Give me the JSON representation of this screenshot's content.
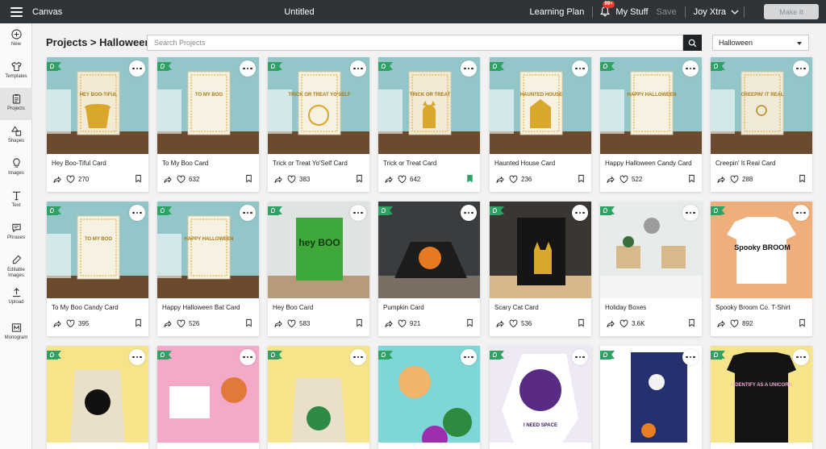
{
  "topbar": {
    "app_name": "Canvas",
    "doc_title": "Untitled",
    "learning_plan": "Learning Plan",
    "notif_badge": "99+",
    "my_stuff": "My Stuff",
    "save": "Save",
    "user": "Joy Xtra",
    "make_it": "Make It"
  },
  "sidebar": {
    "items": [
      {
        "label": "New",
        "icon": "plus-icon"
      },
      {
        "label": "Templates",
        "icon": "tshirt-icon"
      },
      {
        "label": "Projects",
        "icon": "clipboard-icon"
      },
      {
        "label": "Shapes",
        "icon": "shapes-icon"
      },
      {
        "label": "Images",
        "icon": "lightbulb-icon"
      },
      {
        "label": "Text",
        "icon": "text-icon"
      },
      {
        "label": "Phrases",
        "icon": "speech-icon"
      },
      {
        "label": "Editable Images",
        "icon": "edit-image-icon"
      },
      {
        "label": "Upload",
        "icon": "upload-icon"
      },
      {
        "label": "Monogram",
        "icon": "monogram-icon"
      }
    ]
  },
  "header": {
    "breadcrumb": "Projects > Halloween",
    "search_placeholder": "Search Projects",
    "filter_value": "Halloween"
  },
  "cards": [
    {
      "title": "Hey Boo-Tiful Card",
      "likes": "270",
      "saved": false
    },
    {
      "title": "To My Boo Card",
      "likes": "632",
      "saved": false
    },
    {
      "title": "Trick or Treat Yo'Self Card",
      "likes": "383",
      "saved": false
    },
    {
      "title": "Trick or Treat Card",
      "likes": "642",
      "saved": true
    },
    {
      "title": "Haunted House Card",
      "likes": "236",
      "saved": false
    },
    {
      "title": "Happy Halloween Candy Card",
      "likes": "522",
      "saved": false
    },
    {
      "title": "Creepin' It Real Card",
      "likes": "288",
      "saved": false
    },
    {
      "title": "To My Boo Candy Card",
      "likes": "395",
      "saved": false
    },
    {
      "title": "Happy Halloween Bat Card",
      "likes": "526",
      "saved": false
    },
    {
      "title": "Hey Boo Card",
      "likes": "583",
      "saved": false
    },
    {
      "title": "Pumpkin Card",
      "likes": "921",
      "saved": false
    },
    {
      "title": "Scary Cat Card",
      "likes": "536",
      "saved": false
    },
    {
      "title": "Holiday Boxes",
      "likes": "3.6K",
      "saved": false
    },
    {
      "title": "Spooky Broom Co. T-Shirt",
      "likes": "892",
      "saved": false
    },
    {
      "title": "",
      "likes": "",
      "saved": false
    },
    {
      "title": "",
      "likes": "",
      "saved": false
    },
    {
      "title": "",
      "likes": "",
      "saved": false
    },
    {
      "title": "",
      "likes": "",
      "saved": false
    },
    {
      "title": "",
      "likes": "",
      "saved": false
    },
    {
      "title": "",
      "likes": "",
      "saved": false
    },
    {
      "title": "",
      "likes": "",
      "saved": false
    }
  ],
  "card_art": {
    "text": [
      "HEY BOO-TIFUL",
      "TO MY BOO",
      "TRICK OR TREAT YO'SELF",
      "TRICK OR TREAT",
      "HAUNTED HOUSE",
      "HAPPY HALLOWEEN",
      "CREEPIN' IT REAL",
      "TO MY BOO",
      "HAPPY HALLOWEEN",
      "hey BOO",
      "",
      "",
      "",
      "Spooky BROOM",
      "",
      "",
      "",
      "",
      "I NEED SPACE",
      "",
      "I IDENTIFY AS A UNICORN"
    ]
  },
  "colors": {
    "topbar": "#2f3438",
    "flag": "#2ea265",
    "gold": "#d9a82a",
    "wall_teal": "#93c6c8"
  }
}
